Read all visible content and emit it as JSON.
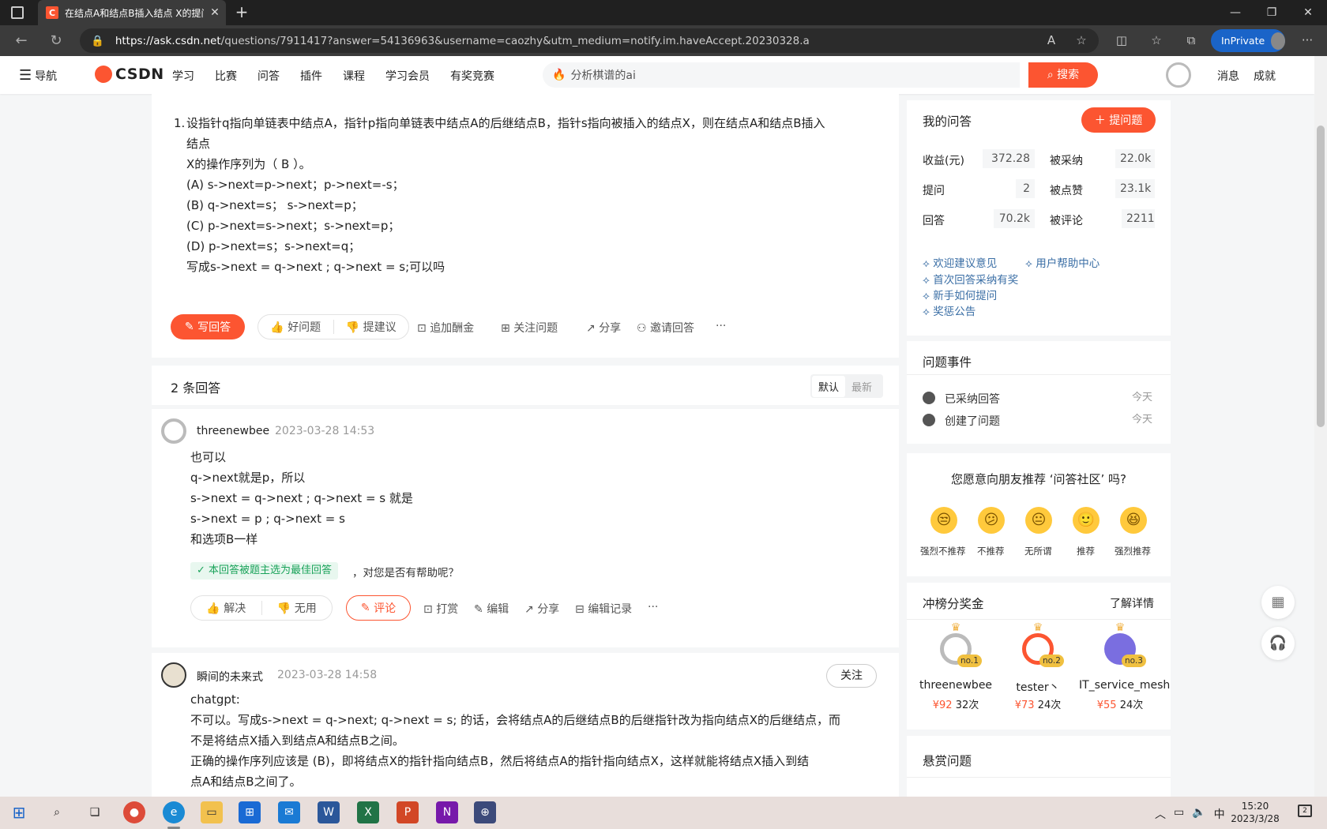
{
  "browser": {
    "tab_title": "在结点A和结点B插入结点 X的提问",
    "tab_favicon_letter": "C",
    "url_host": "https://ask.csdn.net",
    "url_rest": "/questions/7911417?answer=54136963&username=caozhy&utm_medium=notify.im.haveAccept.20230328.a",
    "inprivate_label": "InPrivate"
  },
  "header": {
    "nav_menu": "导航",
    "logo_text": "CSDN",
    "nav_items": [
      "学习",
      "比赛",
      "问答",
      "插件",
      "课程",
      "学习会员",
      "有奖竞赛"
    ],
    "search_placeholder": "分析棋谱的ai",
    "search_button": "搜索",
    "messages": "消息",
    "achievements": "成就"
  },
  "question": {
    "number": "1.",
    "lines": [
      "设指针q指向单链表中结点A，指针p指向单链表中结点A的后继结点B，指针s指向被插入的结点X，则在结点A和结点B插入",
      "结点",
      "X的操作序列为（ B ）。",
      "(A) s->next=p->next；p->next=-s；",
      "(B) q->next=s；  s->next=p；",
      "(C) p->next=s->next；s->next=p；",
      "(D) p->next=s；s->next=q；",
      "写成s->next = q->next ; q->next = s;可以吗"
    ],
    "actions": {
      "write_answer": "写回答",
      "good_question": "好问题",
      "suggest": "提建议",
      "add_bounty": "追加酬金",
      "follow_question": "关注问题",
      "share": "分享",
      "invite": "邀请回答",
      "more": "···"
    }
  },
  "answers": {
    "count_label": "2 条回答",
    "sort_default": "默认",
    "sort_latest": "最新",
    "items": [
      {
        "user": "threenewbee",
        "time": "2023-03-28 14:53",
        "lines": [
          "也可以",
          "q->next就是p，所以",
          "s->next = q->next ; q->next = s 就是",
          "s->next = p ; q->next = s",
          "和选项B一样"
        ],
        "best_badge": "本回答被题主选为最佳回答",
        "helpful_question": "，对您是否有帮助呢？",
        "solve": "解决",
        "useless": "无用",
        "comment": "评论",
        "tip": "打赏",
        "edit": "编辑",
        "share": "分享",
        "edit_history": "编辑记录",
        "more": "···"
      },
      {
        "user": "瞬间的未来式",
        "time": "2023-03-28 14:58",
        "follow": "关注",
        "lines": [
          "chatgpt:",
          "不可以。写成s->next = q->next; q->next = s; 的话，会将结点A的后继结点B的后继指针改为指向结点X的后继结点，而",
          "不是将结点X插入到结点A和结点B之间。",
          "正确的操作序列应该是 (B)，即将结点X的指针指向结点B，然后将结点A的指针指向结点X，这样就能将结点X插入到结",
          "点A和结点B之间了。"
        ]
      }
    ]
  },
  "sidebar": {
    "my_qa": {
      "title": "我的问答",
      "ask_button": "提问题",
      "stats": [
        {
          "label": "收益(元)",
          "value": "372.28"
        },
        {
          "label": "被采纳",
          "value": "22.0k"
        },
        {
          "label": "提问",
          "value": "2"
        },
        {
          "label": "被点赞",
          "value": "23.1k"
        },
        {
          "label": "回答",
          "value": "70.2k"
        },
        {
          "label": "被评论",
          "value": "2211"
        }
      ],
      "links": [
        "欢迎建议意见",
        "用户帮助中心",
        "首次回答采纳有奖",
        "新手如何提问",
        "奖惩公告"
      ]
    },
    "events": {
      "title": "问题事件",
      "items": [
        {
          "text": "已采纳回答",
          "date": "今天"
        },
        {
          "text": "创建了问题",
          "date": "今天"
        }
      ]
    },
    "recommend": {
      "question": "您愿意向朋友推荐 ‘问答社区’ 吗?",
      "options": [
        "强烈不推荐",
        "不推荐",
        "无所谓",
        "推荐",
        "强烈推荐"
      ]
    },
    "bounty": {
      "title": "冲榜分奖金",
      "more": "了解详情",
      "ranks": [
        {
          "tag": "no.1",
          "name": "threenewbee",
          "money": "¥92",
          "times": "32次"
        },
        {
          "tag": "no.2",
          "name": "tester丶",
          "money": "¥73",
          "times": "24次"
        },
        {
          "tag": "no.3",
          "name": "IT_service_mesh",
          "money": "¥55",
          "times": "24次"
        }
      ]
    },
    "reward_questions": {
      "title": "悬赏问题"
    }
  },
  "taskbar": {
    "ime": "中",
    "time": "15:20",
    "date": "2023/3/28",
    "notification_count": "2"
  },
  "colors": {
    "brand": "#fc5531",
    "link": "#3a6ea5",
    "success": "#1aa35a"
  }
}
